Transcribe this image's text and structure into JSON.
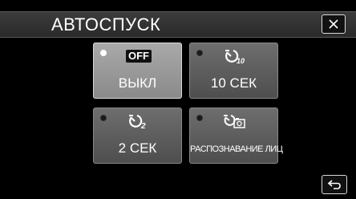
{
  "header": {
    "title": "АВТОСПУСК"
  },
  "options": [
    {
      "id": "off",
      "label": "ВЫКЛ",
      "badge": "OFF",
      "selected": true,
      "icon": "off-icon"
    },
    {
      "id": "10s",
      "label": "10 СЕК",
      "selected": false,
      "icon": "timer-10-icon"
    },
    {
      "id": "2s",
      "label": "2 СЕК",
      "selected": false,
      "icon": "timer-2-icon"
    },
    {
      "id": "face",
      "label": "РАСПОЗНАВАНИЕ ЛИЦ",
      "selected": false,
      "icon": "face-timer-icon"
    }
  ],
  "icons": {
    "close": "close-icon",
    "back": "back-icon"
  },
  "colors": {
    "background": "#000000",
    "tile": "#5e5e5e",
    "tile_selected": "#9a9a9a",
    "text": "#ffffff"
  }
}
